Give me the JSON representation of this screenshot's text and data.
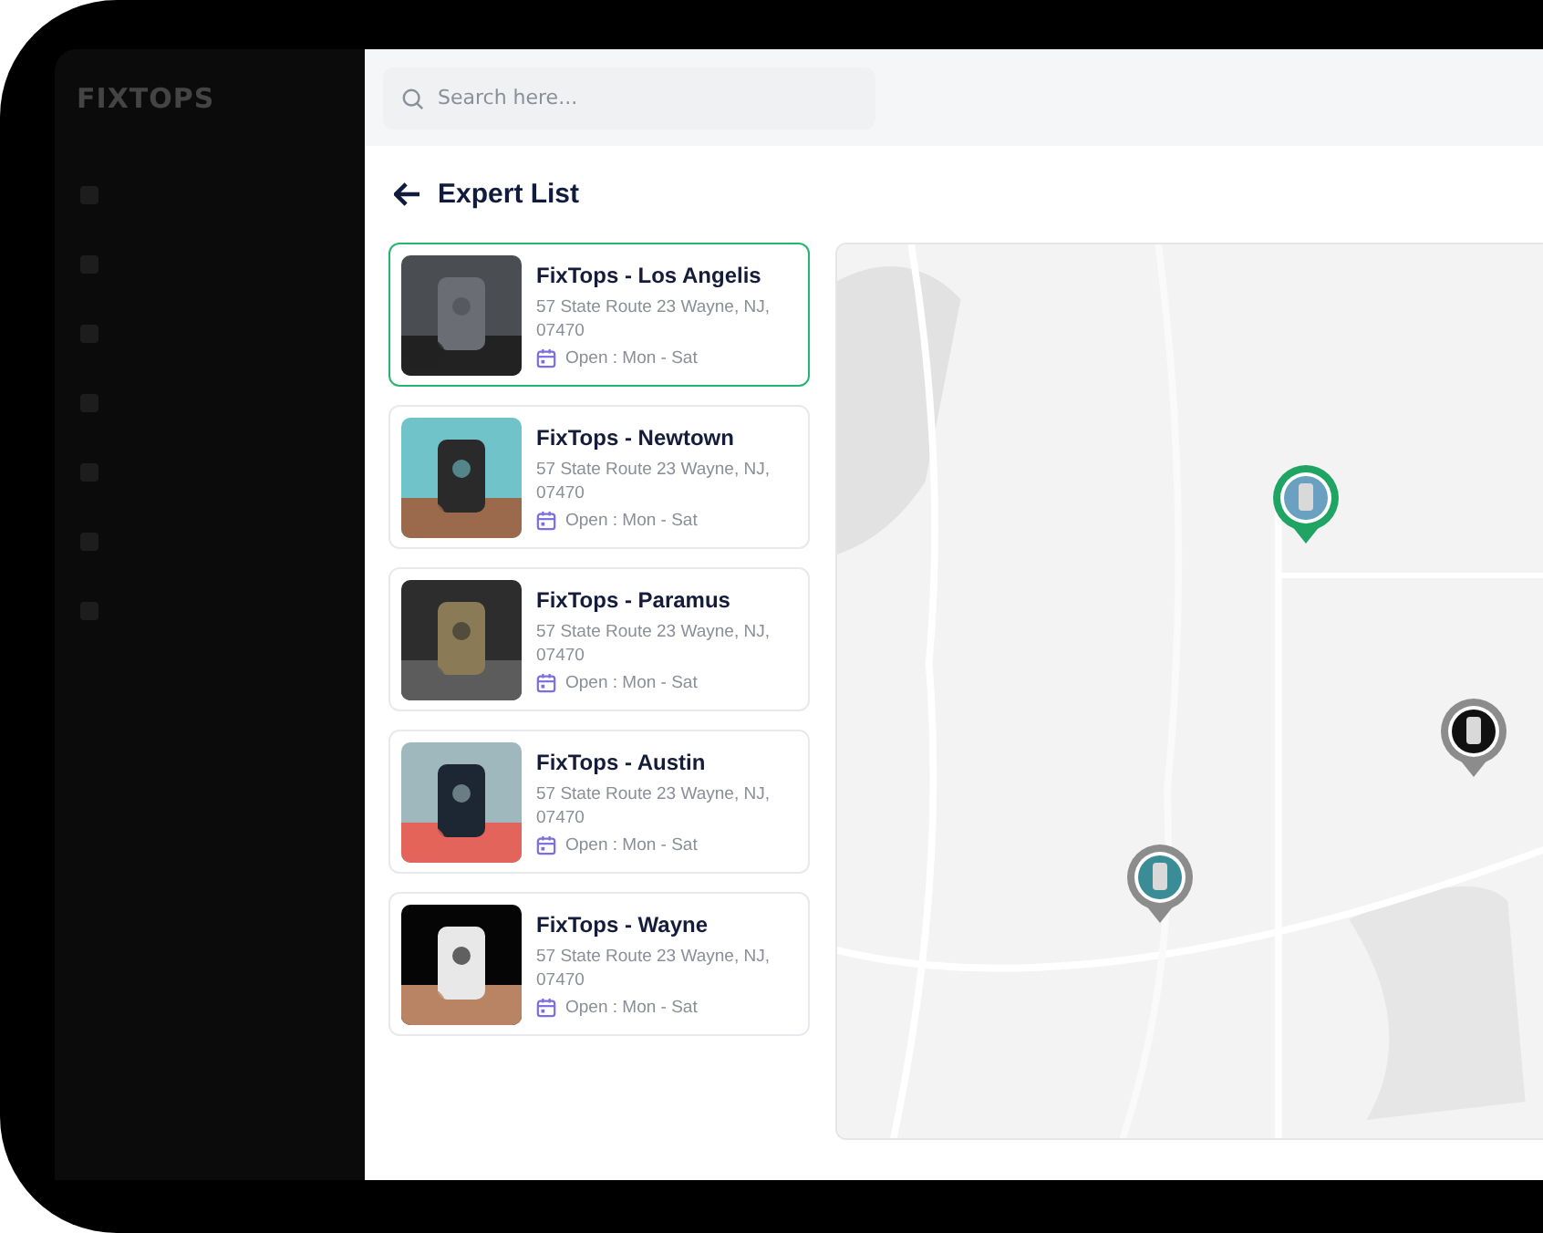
{
  "sidebar": {
    "logo": "FIXTOPS"
  },
  "search": {
    "placeholder": "Search here..."
  },
  "page": {
    "title": "Expert List"
  },
  "experts": [
    {
      "name": "FixTops - Los Angelis",
      "address": "57 State Route 23 Wayne, NJ, 07470",
      "hours": "Open : Mon - Sat",
      "selected": true
    },
    {
      "name": "FixTops - Newtown",
      "address": "57 State Route 23 Wayne, NJ, 07470",
      "hours": "Open : Mon - Sat",
      "selected": false
    },
    {
      "name": "FixTops - Paramus",
      "address": "57 State Route 23 Wayne, NJ, 07470",
      "hours": "Open : Mon - Sat",
      "selected": false
    },
    {
      "name": "FixTops - Austin",
      "address": "57 State Route 23 Wayne, NJ, 07470",
      "hours": "Open : Mon - Sat",
      "selected": false
    },
    {
      "name": "FixTops - Wayne",
      "address": "57 State Route 23 Wayne, NJ, 07470",
      "hours": "Open : Mon - Sat",
      "selected": false
    }
  ],
  "map": {
    "kind": "picture",
    "pins": [
      {
        "selected": true
      },
      {
        "selected": false
      },
      {
        "selected": false
      }
    ]
  }
}
